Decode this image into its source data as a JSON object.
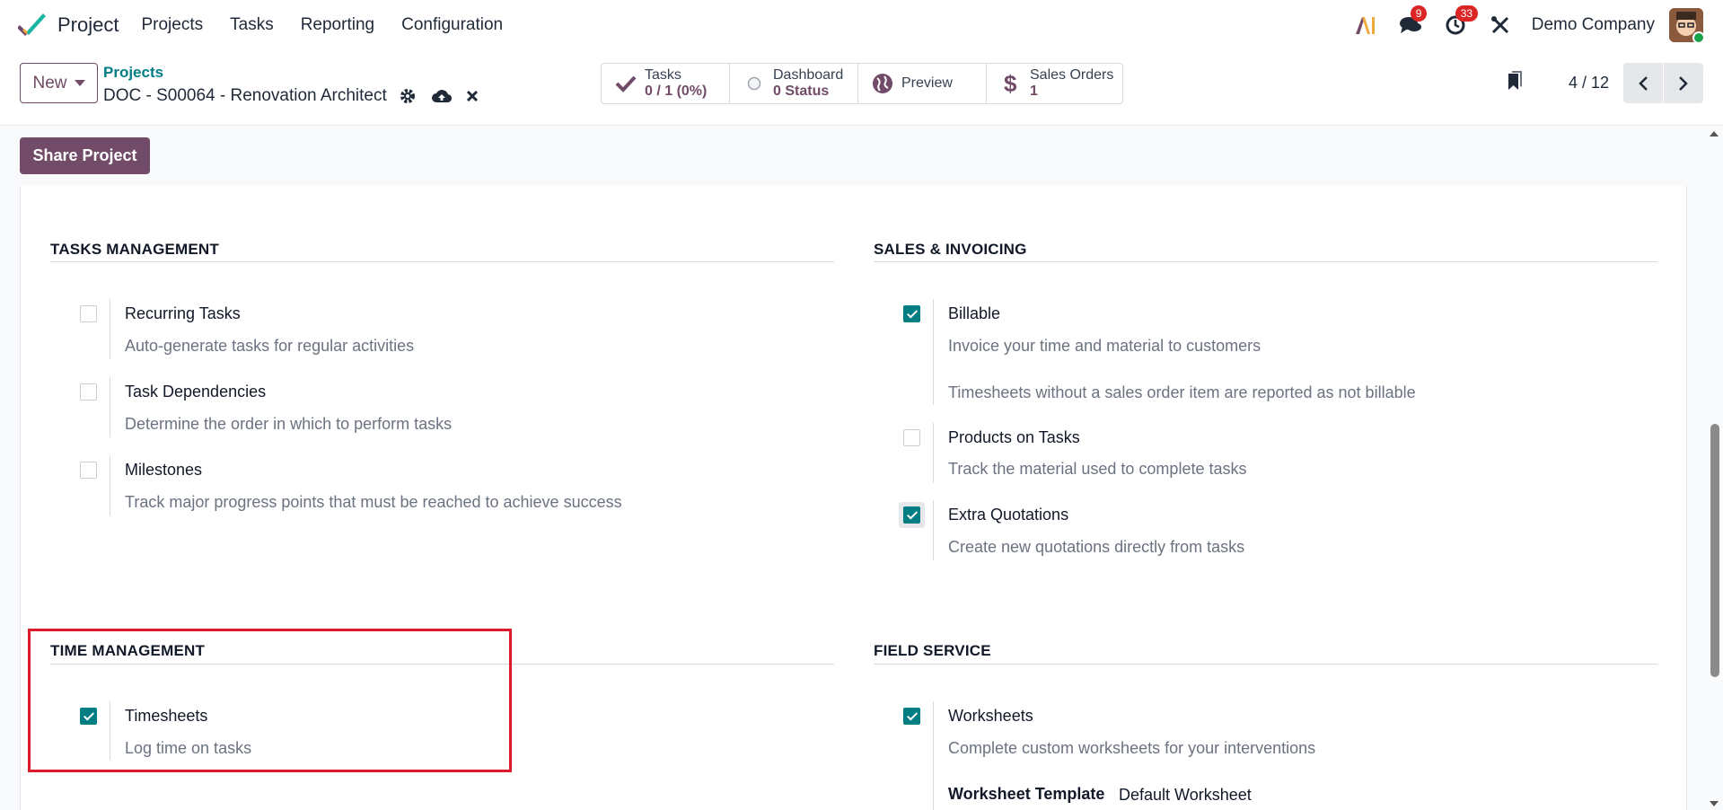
{
  "navbar": {
    "app_name": "Project",
    "menu": [
      "Projects",
      "Tasks",
      "Reporting",
      "Configuration"
    ],
    "chat_count": "9",
    "activity_count": "33",
    "company": "Demo Company"
  },
  "control": {
    "new_label": "New",
    "breadcrumb_parent": "Projects",
    "breadcrumb_current": "DOC - S00064 - Renovation Architect",
    "smart_buttons": {
      "tasks": {
        "label": "Tasks",
        "value": "0 / 1 (0%)"
      },
      "dashboard": {
        "label": "Dashboard",
        "value": "0 Status"
      },
      "preview": {
        "label": "Preview"
      },
      "sales_orders": {
        "label": "Sales Orders",
        "value": "1"
      }
    },
    "pager": "4 / 12"
  },
  "share_label": "Share Project",
  "sections": {
    "tasks_management": {
      "title": "TASKS MANAGEMENT",
      "items": [
        {
          "label": "Recurring Tasks",
          "desc": "Auto-generate tasks for regular activities",
          "checked": false
        },
        {
          "label": "Task Dependencies",
          "desc": "Determine the order in which to perform tasks",
          "checked": false
        },
        {
          "label": "Milestones",
          "desc": "Track major progress points that must be reached to achieve success",
          "checked": false
        }
      ]
    },
    "sales_invoicing": {
      "title": "SALES & INVOICING",
      "items": [
        {
          "label": "Billable",
          "desc": "Invoice your time and material to customers",
          "note": "Timesheets without a sales order item are reported as not billable",
          "checked": true
        },
        {
          "label": "Products on Tasks",
          "desc": "Track the material used to complete tasks",
          "checked": false
        },
        {
          "label": "Extra Quotations",
          "desc": "Create new quotations directly from tasks",
          "checked": true
        }
      ]
    },
    "time_management": {
      "title": "TIME MANAGEMENT",
      "items": [
        {
          "label": "Timesheets",
          "desc": "Log time on tasks",
          "checked": true
        }
      ]
    },
    "field_service": {
      "title": "FIELD SERVICE",
      "items": [
        {
          "label": "Worksheets",
          "desc": "Complete custom worksheets for your interventions",
          "checked": true,
          "template_label": "Worksheet Template",
          "template_value": "Default Worksheet"
        }
      ]
    }
  },
  "colors": {
    "primary": "#714B67",
    "accent": "#017e84",
    "highlight": "#dc1c2c"
  }
}
